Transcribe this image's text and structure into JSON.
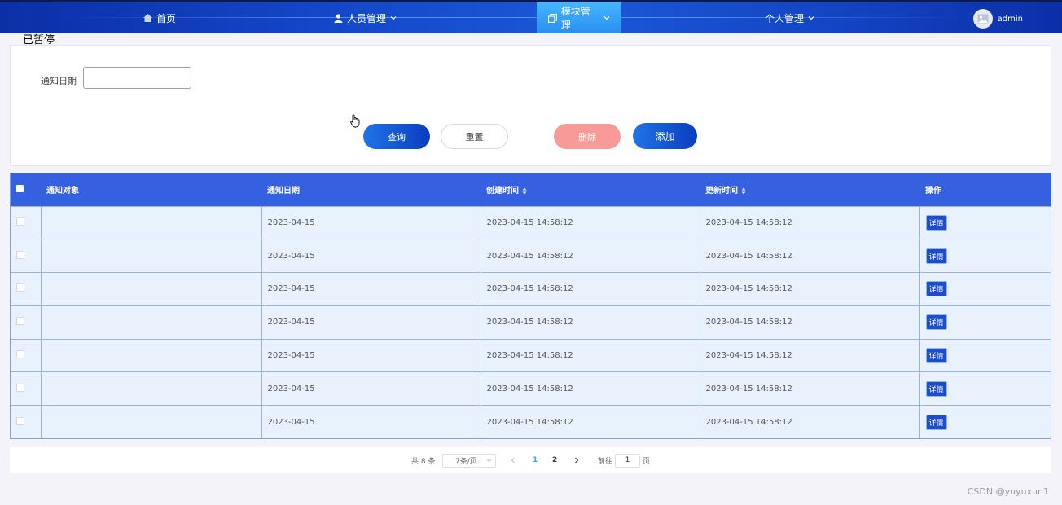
{
  "nav": {
    "home": "首页",
    "personnel": "人员管理",
    "modules": "模块管理",
    "personal": "个人管理",
    "user": "admin"
  },
  "overlay": {
    "paused": "已暂停"
  },
  "search": {
    "date_label": "通知日期",
    "date_value": "",
    "query": "查询",
    "reset": "重置",
    "delete": "删除",
    "add": "添加"
  },
  "table": {
    "headers": [
      "通知对象",
      "通知日期",
      "创建时间",
      "更新时间",
      "操作"
    ],
    "detail_label": "详情",
    "rows": [
      {
        "target": "",
        "date": "2023-04-15",
        "created": "2023-04-15 14:58:12",
        "updated": "2023-04-15 14:58:12"
      },
      {
        "target": "",
        "date": "2023-04-15",
        "created": "2023-04-15 14:58:12",
        "updated": "2023-04-15 14:58:12"
      },
      {
        "target": "",
        "date": "2023-04-15",
        "created": "2023-04-15 14:58:12",
        "updated": "2023-04-15 14:58:12"
      },
      {
        "target": "",
        "date": "2023-04-15",
        "created": "2023-04-15 14:58:12",
        "updated": "2023-04-15 14:58:12"
      },
      {
        "target": "",
        "date": "2023-04-15",
        "created": "2023-04-15 14:58:12",
        "updated": "2023-04-15 14:58:12"
      },
      {
        "target": "",
        "date": "2023-04-15",
        "created": "2023-04-15 14:58:12",
        "updated": "2023-04-15 14:58:12"
      },
      {
        "target": "",
        "date": "2023-04-15",
        "created": "2023-04-15 14:58:12",
        "updated": "2023-04-15 14:58:12"
      }
    ]
  },
  "pagination": {
    "total": "共 8 条",
    "page_size": "7条/页",
    "pages": [
      "1",
      "2"
    ],
    "current_page": "1",
    "goto_label": "前往",
    "goto_value": "1",
    "page_suffix": "页"
  },
  "watermark": "CSDN @yuyuxun1",
  "colors": {
    "nav_bg": "#1446c9",
    "table_header": "#3560df",
    "primary_button": "#0a3dc0",
    "delete_button": "#f89a98",
    "active_page": "#409eff"
  }
}
